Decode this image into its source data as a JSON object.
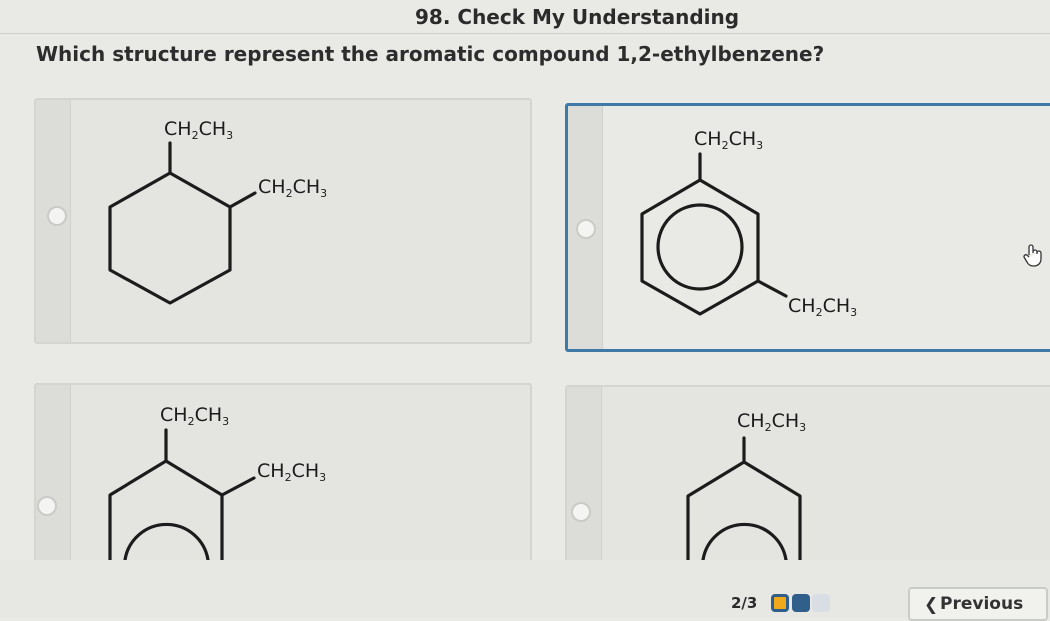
{
  "header": {
    "title": "98. Check My Understanding",
    "question": "Which structure represent the aromatic compound 1,2-ethylbenzene?"
  },
  "options": [
    {
      "id": "a",
      "ring": "cyclohexane",
      "substituents": [
        "CH2CH3",
        "CH2CH3"
      ],
      "selected": false
    },
    {
      "id": "b",
      "ring": "benzene",
      "substituents": [
        "CH2CH3",
        "CH2CH3"
      ],
      "selected": true
    },
    {
      "id": "c",
      "ring": "benzene",
      "substituents": [
        "CH2CH3",
        "CH2CH3"
      ],
      "selected": false
    },
    {
      "id": "d",
      "ring": "benzene",
      "substituents": [
        "CH2CH3"
      ],
      "selected": false
    }
  ],
  "labels": {
    "ethyl_main": "CH",
    "ethyl_sub1": "2",
    "ethyl_mid": "CH",
    "ethyl_sub2": "3"
  },
  "footer": {
    "page_indicator": "2/3",
    "previous_label": "Previous"
  },
  "colors": {
    "selected_border": "#3f79a8",
    "progress_active": "#f0a81c",
    "progress_current": "#2f5f8a",
    "progress_inactive": "#d9dde4"
  }
}
